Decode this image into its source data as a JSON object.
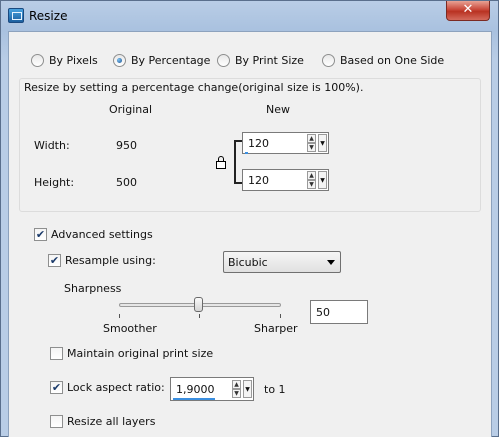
{
  "window": {
    "title": "Resize",
    "close_glyph": "✕"
  },
  "modes": [
    {
      "label": "By Pixels",
      "selected": false
    },
    {
      "label": "By Percentage",
      "selected": true
    },
    {
      "label": "By Print Size",
      "selected": false
    },
    {
      "label": "Based on One Side",
      "selected": false
    }
  ],
  "percentage": {
    "caption": "Resize by setting a percentage change(original size is 100%).",
    "col_original": "Original",
    "col_new": "New",
    "width_label": "Width:",
    "width_original": "950",
    "width_new": "120",
    "height_label": "Height:",
    "height_original": "500",
    "height_new": "120"
  },
  "advanced": {
    "label": "Advanced settings",
    "checked": true,
    "resample_label": "Resample using:",
    "resample_checked": true,
    "resample_value": "Bicubic",
    "sharpness_label": "Sharpness",
    "sharpness_value": "50",
    "sharpness_min_label": "Smoother",
    "sharpness_max_label": "Sharper",
    "maintain_label": "Maintain original print size",
    "maintain_checked": false,
    "aspect_label": "Lock aspect ratio:",
    "aspect_checked": true,
    "aspect_value": "1,9000",
    "aspect_suffix": "to 1",
    "all_layers_label": "Resize all layers",
    "all_layers_checked": false
  },
  "icons": {
    "check_glyph": "✔",
    "up_glyph": "▲",
    "down_glyph": "▼"
  }
}
